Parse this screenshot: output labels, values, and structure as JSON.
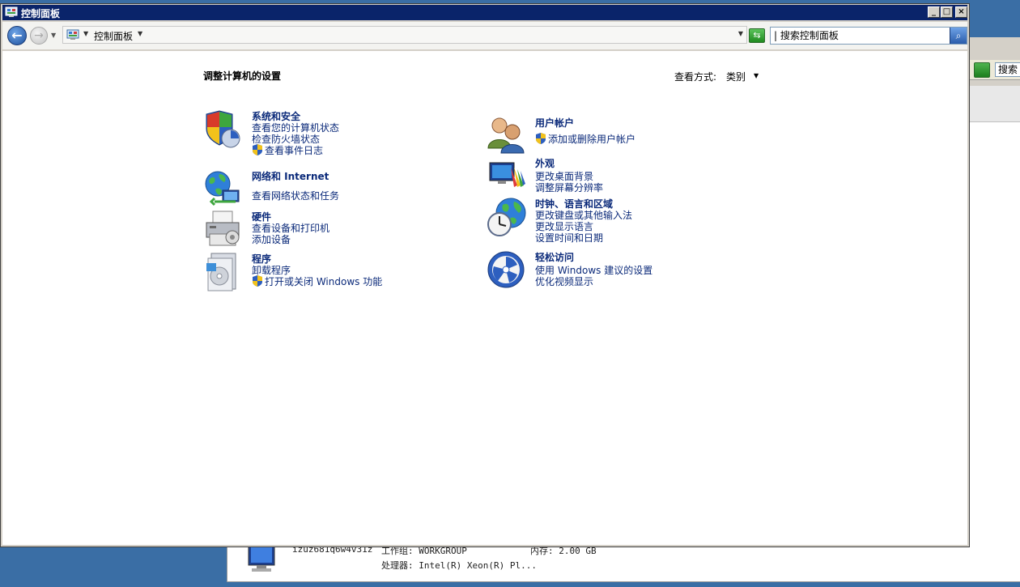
{
  "window": {
    "title": "控制面板"
  },
  "titlebar_buttons": {
    "minimize": "_",
    "maximize": "□",
    "close": "×"
  },
  "navbar": {
    "breadcrumb": "控制面板",
    "search_placeholder": "| 搜索控制面板"
  },
  "main": {
    "heading": "调整计算机的设置",
    "view_by_label": "查看方式:",
    "view_by_value": "类别"
  },
  "categories_left": [
    {
      "title": "系统和安全",
      "icon": "shield-icon",
      "links": [
        "查看您的计算机状态",
        "检查防火墙状态",
        "查看事件日志"
      ]
    },
    {
      "title": "网络和 Internet",
      "icon": "network-icon",
      "links": [
        "查看网络状态和任务"
      ]
    },
    {
      "title": "硬件",
      "icon": "printer-icon",
      "links": [
        "查看设备和打印机",
        "添加设备"
      ]
    },
    {
      "title": "程序",
      "icon": "programs-icon",
      "links": [
        "卸载程序",
        "打开或关闭 Windows 功能"
      ]
    }
  ],
  "categories_right": [
    {
      "title": "用户帐户",
      "icon": "users-icon",
      "links": [
        "添加或删除用户帐户"
      ]
    },
    {
      "title": "外观",
      "icon": "appearance-icon",
      "links": [
        "更改桌面背景",
        "调整屏幕分辨率"
      ]
    },
    {
      "title": "时钟、语言和区域",
      "icon": "clock-globe-icon",
      "links": [
        "更改键盘或其他输入法",
        "更改显示语言",
        "设置时间和日期"
      ]
    },
    {
      "title": "轻松访问",
      "icon": "ease-of-access-icon",
      "links": [
        "使用 Windows 建议的设置",
        "优化视频显示"
      ]
    }
  ],
  "background_window": {
    "search_text": "搜索",
    "computer_name": "izuz681q6w4v31z",
    "workgroup": "工作组: WORKGROUP",
    "memory": "内存: 2.00 GB",
    "processor": "处理器: Intel(R) Xeon(R) Pl..."
  },
  "colors": {
    "titlebar": "#0a246a",
    "link": "#0b2a7a",
    "desktop": "#3a6ea5"
  }
}
